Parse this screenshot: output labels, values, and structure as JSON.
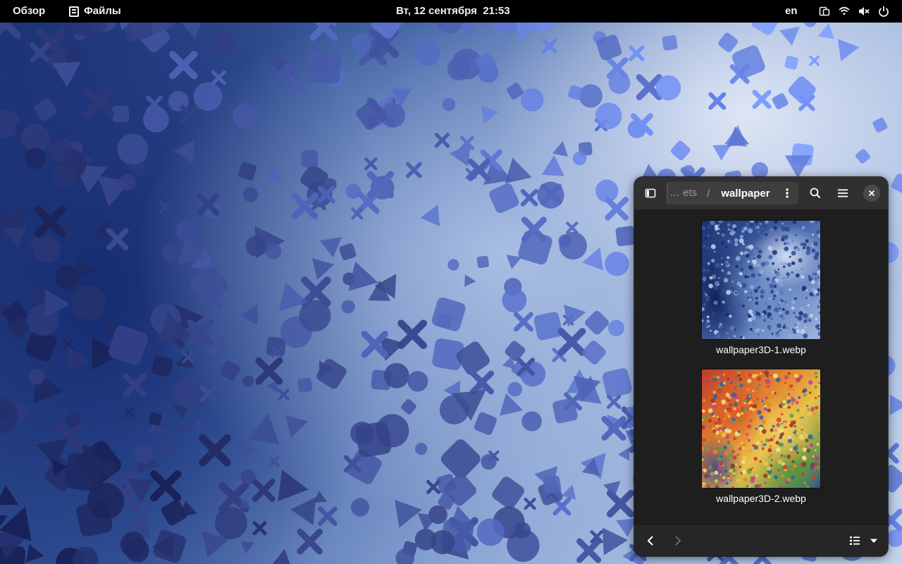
{
  "topbar": {
    "activities_label": "Обзор",
    "app_label": "Файлы",
    "clock": "Вт, 12 сентября  21:53",
    "input_lang": "en"
  },
  "status_icons": [
    "screen-share-icon",
    "wifi-icon",
    "volume-muted-icon",
    "power-icon"
  ],
  "file_window": {
    "path_prev": "… ets",
    "path_separator": "/",
    "path_current": "wallpaper",
    "files": [
      {
        "name": "wallpaper3D-1.webp",
        "thumbnail": "blue-shapes"
      },
      {
        "name": "wallpaper3D-2.webp",
        "thumbnail": "colorful-shapes"
      }
    ]
  },
  "colors": {
    "topbar_bg": "#000000",
    "window_bg": "#1e1e1e",
    "headerbar_bg": "#303030",
    "pathbar_bg": "#3e3e3e",
    "text": "#ffffff"
  }
}
